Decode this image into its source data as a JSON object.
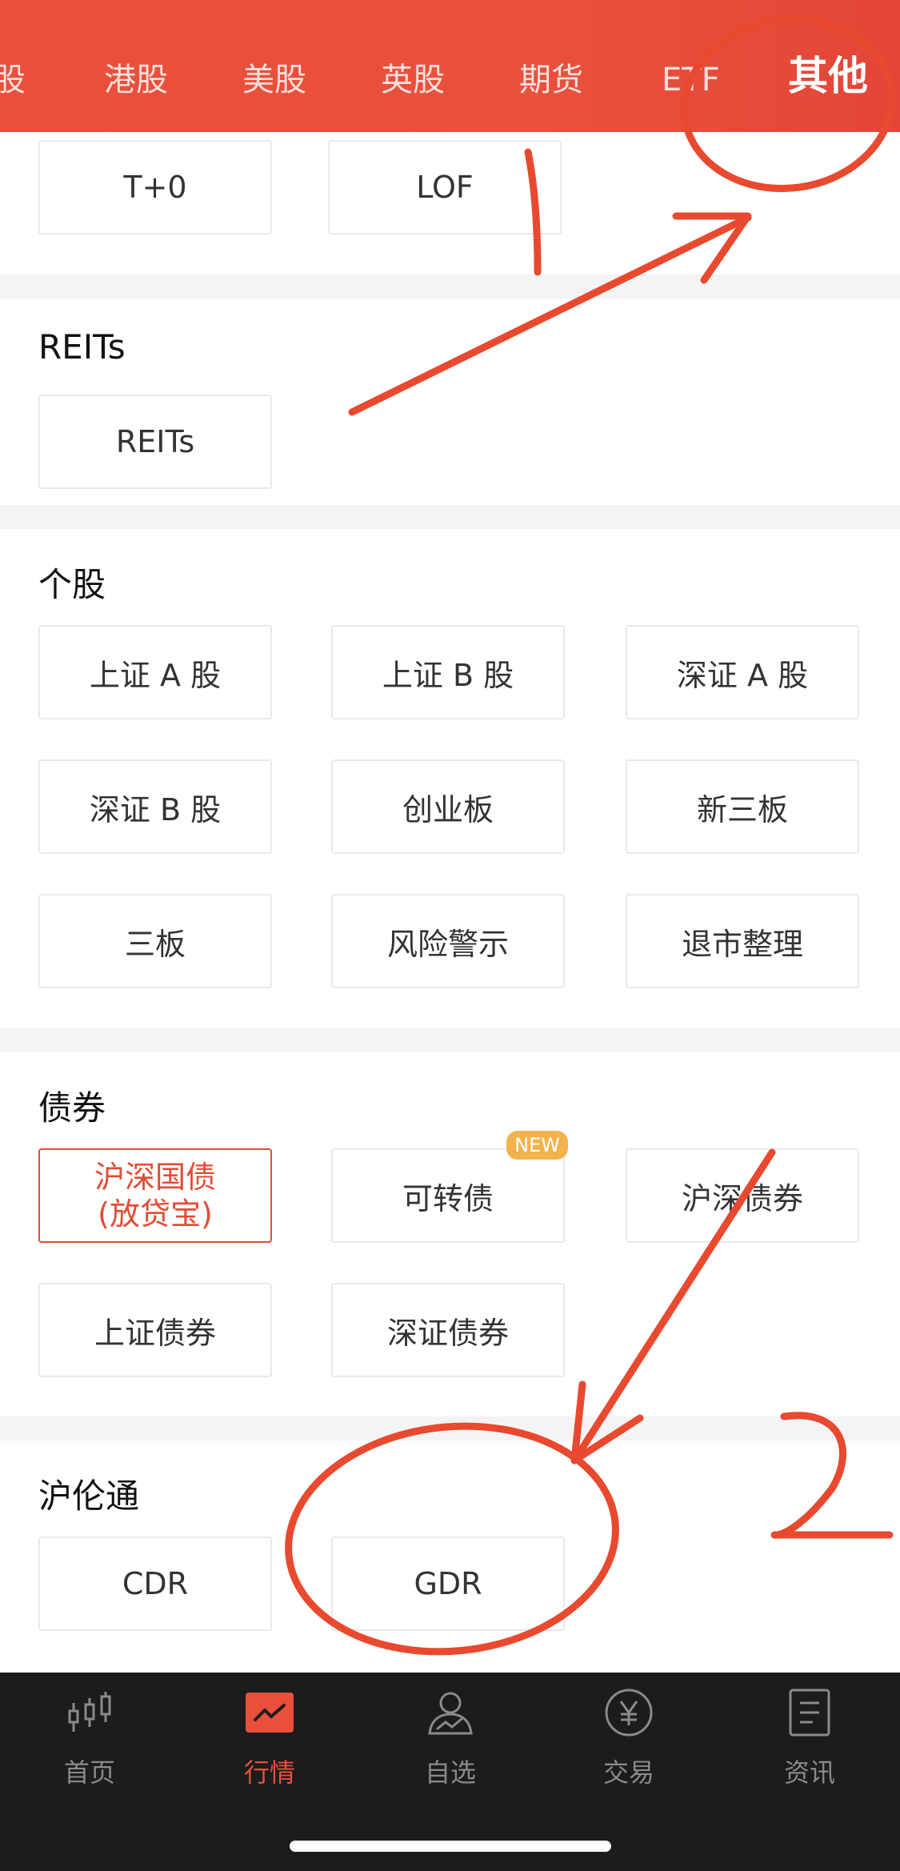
{
  "header": {
    "tabs": [
      {
        "label": "股"
      },
      {
        "label": "港股"
      },
      {
        "label": "美股"
      },
      {
        "label": "英股"
      },
      {
        "label": "期货"
      },
      {
        "label": "ETF"
      },
      {
        "label": "其他"
      }
    ],
    "active_tab": "其他"
  },
  "sections": {
    "fund": {
      "items": [
        {
          "label": "T+0"
        },
        {
          "label": "LOF"
        }
      ]
    },
    "reits": {
      "title": "REITs",
      "items": [
        {
          "label": "REITs"
        }
      ]
    },
    "stocks": {
      "title": "个股",
      "items": [
        {
          "label": "上证 A 股"
        },
        {
          "label": "上证 B 股"
        },
        {
          "label": "深证 A 股"
        },
        {
          "label": "深证 B 股"
        },
        {
          "label": "创业板"
        },
        {
          "label": "新三板"
        },
        {
          "label": "三板"
        },
        {
          "label": "风险警示"
        },
        {
          "label": "退市整理"
        }
      ]
    },
    "bonds": {
      "title": "债券",
      "highlight_line1": "沪深国债",
      "highlight_line2": "(放贷宝)",
      "items": [
        {
          "label": "可转债",
          "badge": "NEW"
        },
        {
          "label": "沪深债券"
        },
        {
          "label": "上证债券"
        },
        {
          "label": "深证债券"
        }
      ]
    },
    "hlt": {
      "title": "沪伦通",
      "items": [
        {
          "label": "CDR"
        },
        {
          "label": "GDR"
        }
      ]
    }
  },
  "bottom_nav": [
    {
      "label": "首页",
      "icon": "candlestick-icon"
    },
    {
      "label": "行情",
      "icon": "market-chart-icon",
      "active": true
    },
    {
      "label": "自选",
      "icon": "user-chart-icon"
    },
    {
      "label": "交易",
      "icon": "yen-icon"
    },
    {
      "label": "资讯",
      "icon": "news-icon"
    }
  ],
  "colors": {
    "accent": "#e94f3b",
    "annotation": "#e8492f",
    "badge": "#f3b24d"
  }
}
